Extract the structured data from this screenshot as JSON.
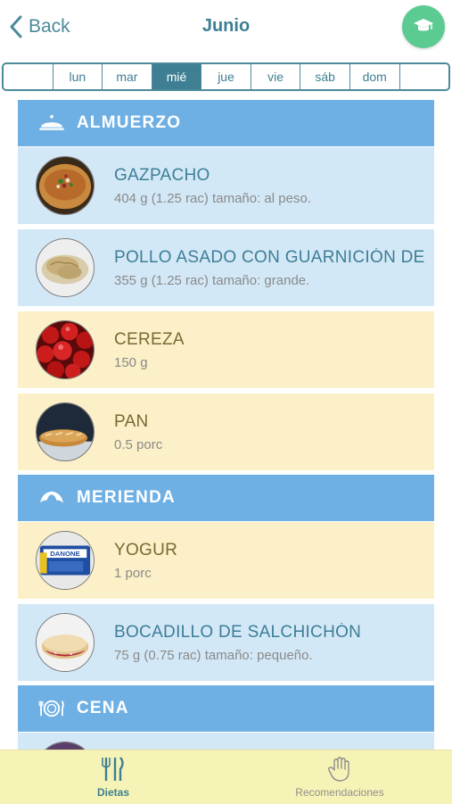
{
  "header": {
    "back_label": "Back",
    "title": "Junio",
    "action_icon": "graduation-cap-icon"
  },
  "days": [
    "",
    "lun",
    "mar",
    "mié",
    "jue",
    "vie",
    "sáb",
    "dom",
    ""
  ],
  "active_day": "mié",
  "sections": [
    {
      "id": "almuerzo",
      "label": "ALMUERZO",
      "icon": "serving-cloche-icon"
    },
    {
      "id": "merienda",
      "label": "MERIENDA",
      "icon": "croissant-icon"
    },
    {
      "id": "cena",
      "label": "CENA",
      "icon": "plate-cutlery-icon"
    }
  ],
  "items": [
    {
      "name": "GAZPACHO",
      "detail": "404 g (1.25 rac) tamaño: al peso.",
      "tone": "blue",
      "image": "gazpacho-image"
    },
    {
      "name": "POLLO ASADO CON GUARNICIÓN DE",
      "detail": "355 g (1.25 rac) tamaño: grande.",
      "tone": "blue",
      "image": "roast-chicken-image"
    },
    {
      "name": "CEREZA",
      "detail": "150 g",
      "tone": "yellow",
      "image": "cherries-image"
    },
    {
      "name": "PAN",
      "detail": "0.5 porc",
      "tone": "yellow",
      "image": "bread-image"
    },
    {
      "name": "YOGUR",
      "detail": "1 porc",
      "tone": "yellow",
      "image": "yogurt-image"
    },
    {
      "name": "BOCADILLO DE SALCHICHÓN",
      "detail": "75 g (0.75 rac) tamaño: pequeño.",
      "tone": "blue",
      "image": "sandwich-image"
    }
  ],
  "bottom_nav": [
    {
      "label": "Dietas",
      "icon": "cutlery-icon",
      "active": true
    },
    {
      "label": "Recomendaciones",
      "icon": "hand-icon",
      "active": false
    }
  ],
  "colors": {
    "primary": "#3e7f93",
    "section_blue": "#6fb0e4",
    "item_blue": "#d3e8f6",
    "item_yellow": "#fbf0c7",
    "accent_green": "#5ccb92",
    "bottom_nav_bg": "#f6f3b6"
  }
}
